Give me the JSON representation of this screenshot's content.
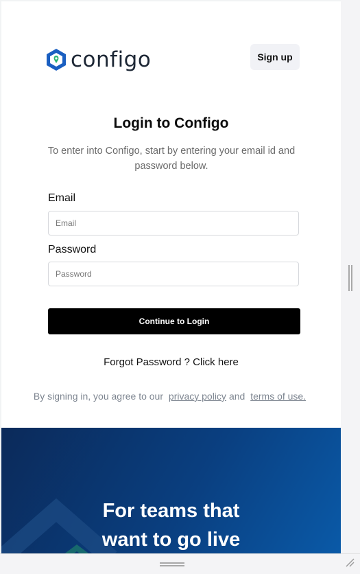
{
  "brand": {
    "name": "configo",
    "accent": "#1a5fc1",
    "accent_green": "#2bb673"
  },
  "header": {
    "signup_label": "Sign up"
  },
  "login": {
    "title": "Login to Configo",
    "subtitle": "To enter into Configo, start by entering your email id and password below.",
    "email_label": "Email",
    "email_placeholder": "Email",
    "email_value": "",
    "password_label": "Password",
    "password_placeholder": "Password",
    "password_value": "",
    "continue_label": "Continue to Login",
    "forgot_text": "Forgot Password ? Click here"
  },
  "terms": {
    "prefix": "By signing in, you agree to our",
    "privacy_label": "privacy policy",
    "and": "and",
    "terms_label": "terms of use."
  },
  "promo": {
    "line1": "For teams that",
    "line2": "want to go live"
  }
}
